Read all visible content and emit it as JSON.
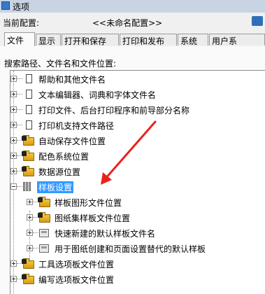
{
  "window": {
    "title": "选项"
  },
  "profile": {
    "label": "当前配置:",
    "value": "<<未命名配置>>"
  },
  "tabs": [
    "文件",
    "显示",
    "打开和保存",
    "打印和发布",
    "系统",
    "用户系"
  ],
  "panel": {
    "caption": "搜索路径、文件名和文件位置:"
  },
  "tree": [
    {
      "label": "帮助和其他文件名",
      "icon": "document-icon",
      "expander": "plus"
    },
    {
      "label": "文本编辑器、词典和字体文件名",
      "icon": "document-icon",
      "expander": "plus"
    },
    {
      "label": "打印文件、后台打印程序和前导部分名称",
      "icon": "document-icon",
      "expander": "plus"
    },
    {
      "label": "打印机支持文件路径",
      "icon": "document-icon",
      "expander": "plus"
    },
    {
      "label": "自动保存文件位置",
      "icon": "folder-icon",
      "expander": "plus"
    },
    {
      "label": "配色系统位置",
      "icon": "folder-icon",
      "expander": "plus"
    },
    {
      "label": "数据源位置",
      "icon": "folder-icon",
      "expander": "plus"
    },
    {
      "label": "样板设置",
      "icon": "books-icon",
      "expander": "minus",
      "selected": true
    },
    {
      "label": "样板图形文件位置",
      "icon": "folder-icon",
      "expander": "plus",
      "child": true
    },
    {
      "label": "图纸集样板文件位置",
      "icon": "folder-icon",
      "expander": "plus",
      "child": true
    },
    {
      "label": "快速新建的默认样板文件名",
      "icon": "template-icon",
      "expander": "plus",
      "child": true
    },
    {
      "label": "用于图纸创建和页面设置替代的默认样板",
      "icon": "template-icon",
      "expander": "plus",
      "child": true
    },
    {
      "label": "工具选项板文件位置",
      "icon": "folder-icon",
      "expander": "plus"
    },
    {
      "label": "编写选项板文件位置",
      "icon": "folder-icon",
      "expander": "plus"
    }
  ],
  "colors": {
    "selection": "#3399ff",
    "annotation_arrow": "#e8231e"
  }
}
